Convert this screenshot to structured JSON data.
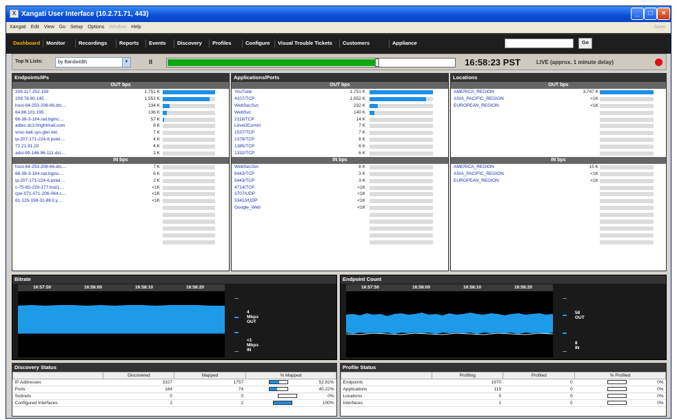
{
  "window": {
    "title": "Xangati User Interface (10.2.71.71, 443)"
  },
  "menu": {
    "items": [
      "Xangati",
      "Edit",
      "View",
      "Go",
      "Setup",
      "Options"
    ],
    "disabled": "Window",
    "help": "Help",
    "save": "Save"
  },
  "nav": {
    "tabs": [
      "Dashboard",
      "Monitor",
      "Recordings",
      "Reports",
      "Events",
      "Discovery",
      "Profiles",
      "Configure",
      "Visual Trouble Tickets",
      "Customers",
      "Appliance"
    ],
    "active": "Dashboard",
    "search_value": "",
    "go_label": "Go"
  },
  "controls": {
    "topn_label": "Top N Lists:",
    "topn_value": "by Bandwidth",
    "pause_label": "II",
    "progress_fraction": 0.73,
    "clock": "16:58:23 PST",
    "live": "LIVE (approx. 1 minute  delay)"
  },
  "endpoints": {
    "title": "Endpoints/IPs",
    "out_header": "OUT bps",
    "out": [
      {
        "name": "208.117.252.159",
        "value": "1,751 K",
        "pct": 1.0
      },
      {
        "name": "209.78.80.145",
        "value": "1,552 K",
        "pct": 0.89
      },
      {
        "name": "host-64-253-208-66.dtc....",
        "value": "234 K",
        "pct": 0.13
      },
      {
        "name": "64.86.101.195",
        "value": "136 K",
        "pct": 0.08
      },
      {
        "name": "66-38-3-164.nat.bginc....",
        "value": "57 K",
        "pct": 0.03
      },
      {
        "name": "adtec.dc3.brightmail.com",
        "value": "8 K",
        "pct": 0
      },
      {
        "name": "vnsc-bak.sys.gtei.net.",
        "value": "7 K",
        "pct": 0
      },
      {
        "name": "ip-207-171-224-6.pstel....",
        "value": "4 K",
        "pct": 0
      },
      {
        "name": "72.21.91.20",
        "value": "4 K",
        "pct": 0
      },
      {
        "name": "adsl-99-146-96-111.dsl....",
        "value": "2 K",
        "pct": 0
      }
    ],
    "in_header": "IN bps",
    "in": [
      {
        "name": "host-64-253-208-66.dtc....",
        "value": "7 K",
        "pct": 0
      },
      {
        "name": "66-38-3-164.nat.bginc....",
        "value": "6 K",
        "pct": 0
      },
      {
        "name": "ip-207-171-224-6.pstel....",
        "value": "2 K",
        "pct": 0
      },
      {
        "name": "c-75-65-229-177.hsd1....",
        "value": "<1K",
        "pct": 0
      },
      {
        "name": "cpe-071-071-206-064.c....",
        "value": "<1K",
        "pct": 0
      },
      {
        "name": "81-125-198-31-88.ll.y....",
        "value": "<1K",
        "pct": 0
      }
    ]
  },
  "applications": {
    "title": "Applications/Ports",
    "out_header": "OUT bps",
    "out": [
      {
        "name": "YouTube",
        "value": "1,751 K",
        "pct": 1.0
      },
      {
        "name": "4107/TCP",
        "value": "1,552 K",
        "pct": 0.89
      },
      {
        "name": "WebSecSvc",
        "value": "232 K",
        "pct": 0.13
      },
      {
        "name": "WebSvc",
        "value": "140 K",
        "pct": 0.08
      },
      {
        "name": "2118/TCP",
        "value": "14 K",
        "pct": 0
      },
      {
        "name": "Level3Comm",
        "value": "7 K",
        "pct": 0
      },
      {
        "name": "1537/TCP",
        "value": "7 K",
        "pct": 0
      },
      {
        "name": "1378/TCP",
        "value": "6 K",
        "pct": 0
      },
      {
        "name": "1385/TCP",
        "value": "6 K",
        "pct": 0
      },
      {
        "name": "1332/TCP",
        "value": "6 K",
        "pct": 0
      }
    ],
    "in_header": "IN bps",
    "in": [
      {
        "name": "WebSecSvc",
        "value": "8 K",
        "pct": 0
      },
      {
        "name": "6443/TCP",
        "value": "3 K",
        "pct": 0
      },
      {
        "name": "5443/TCP",
        "value": "3 K",
        "pct": 0
      },
      {
        "name": "4714/TCP",
        "value": "<1K",
        "pct": 0
      },
      {
        "name": "3707/UDP",
        "value": "<1K",
        "pct": 0
      },
      {
        "name": "53410/UDP",
        "value": "<1K",
        "pct": 0
      },
      {
        "name": "Google_Web",
        "value": "<1K",
        "pct": 0
      }
    ]
  },
  "locations": {
    "title": "Locations",
    "out_header": "OUT bps",
    "out": [
      {
        "name": "AMERICA_REGION",
        "value": "3,747 K",
        "pct": 1.0
      },
      {
        "name": "ASIA_PACIFIC_REGION",
        "value": "<1K",
        "pct": 0
      },
      {
        "name": "EUROPEAN_REGION",
        "value": "<1K",
        "pct": 0
      }
    ],
    "in_header": "IN bps",
    "in": [
      {
        "name": "AMERICA_REGION",
        "value": "15 K",
        "pct": 0
      },
      {
        "name": "ASIA_PACIFIC_REGION",
        "value": "<1K",
        "pct": 0
      },
      {
        "name": "EUROPEAN_REGION",
        "value": "<1K",
        "pct": 0
      }
    ]
  },
  "bitrate": {
    "title": "Bitrate",
    "times": [
      "16:57:50",
      "16:58:00",
      "16:58:10",
      "16:58:20"
    ],
    "out_value": "4",
    "out_unit": "Mbps",
    "out_dir": "OUT",
    "in_value": "<1",
    "in_unit": "Mbps",
    "in_dir": "IN"
  },
  "endpoint_count": {
    "title": "Endpoint Count",
    "times": [
      "16:57:50",
      "16:58:00",
      "16:58:10",
      "16:58:20"
    ],
    "out_value": "58",
    "out_dir": "OUT",
    "in_value": "8",
    "in_dir": "IN"
  },
  "discovery": {
    "title": "Discovery Status",
    "headers": [
      "",
      "Discovered",
      "Mapped",
      "% Mapped"
    ],
    "rows": [
      {
        "label": "IP Addresses",
        "discovered": "3327",
        "mapped": "1757",
        "pct": "52.81%",
        "frac": 0.5281
      },
      {
        "label": "Ports",
        "discovered": "184",
        "mapped": "74",
        "pct": "40.22%",
        "frac": 0.4022
      },
      {
        "label": "Subnets",
        "discovered": "0",
        "mapped": "0",
        "pct": "0%",
        "frac": 0
      },
      {
        "label": "Configured Interfaces",
        "discovered": "2",
        "mapped": "2",
        "pct": "100%",
        "frac": 1.0
      }
    ]
  },
  "profile": {
    "title": "Profile Status",
    "headers": [
      "",
      "Profiling",
      "Profiled",
      "% Profiled"
    ],
    "rows": [
      {
        "label": "Endpoints",
        "profiling": "1970",
        "profiled": "0",
        "pct": "0%",
        "frac": 0
      },
      {
        "label": "Applications",
        "profiling": "119",
        "profiled": "0",
        "pct": "0%",
        "frac": 0
      },
      {
        "label": "Locations",
        "profiling": "5",
        "profiled": "0",
        "pct": "0%",
        "frac": 0
      },
      {
        "label": "Interfaces",
        "profiling": "1",
        "profiled": "0",
        "pct": "0%",
        "frac": 0
      }
    ]
  }
}
